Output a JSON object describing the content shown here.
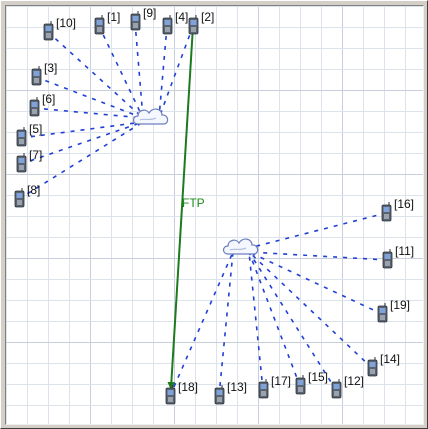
{
  "colors": {
    "grid": "#dde3ec",
    "link": "#1f3fd6",
    "ftp": "#1e7a1e",
    "device_body": "#5a6470",
    "device_screen": "#7fa2d8",
    "cloud_stroke": "#6d7fbf"
  },
  "icons": {
    "node": "mobile-node-icon",
    "access_point": "cloud-icon"
  },
  "nodes": [
    {
      "label": "[1]"
    },
    {
      "label": "[2]"
    },
    {
      "label": "[3]"
    },
    {
      "label": "[4]"
    },
    {
      "label": "[5]"
    },
    {
      "label": "[6]"
    },
    {
      "label": "[7]"
    },
    {
      "label": "[8]"
    },
    {
      "label": "[9]"
    },
    {
      "label": "[10]"
    },
    {
      "label": "[11]"
    },
    {
      "label": "[12]"
    },
    {
      "label": "[13]"
    },
    {
      "label": "[14]"
    },
    {
      "label": "[15]"
    },
    {
      "label": "[16]"
    },
    {
      "label": "[17]"
    },
    {
      "label": "[18]"
    },
    {
      "label": "[19]"
    }
  ],
  "flow": {
    "label": "FTP",
    "from": "[2]",
    "to": "[18]"
  }
}
